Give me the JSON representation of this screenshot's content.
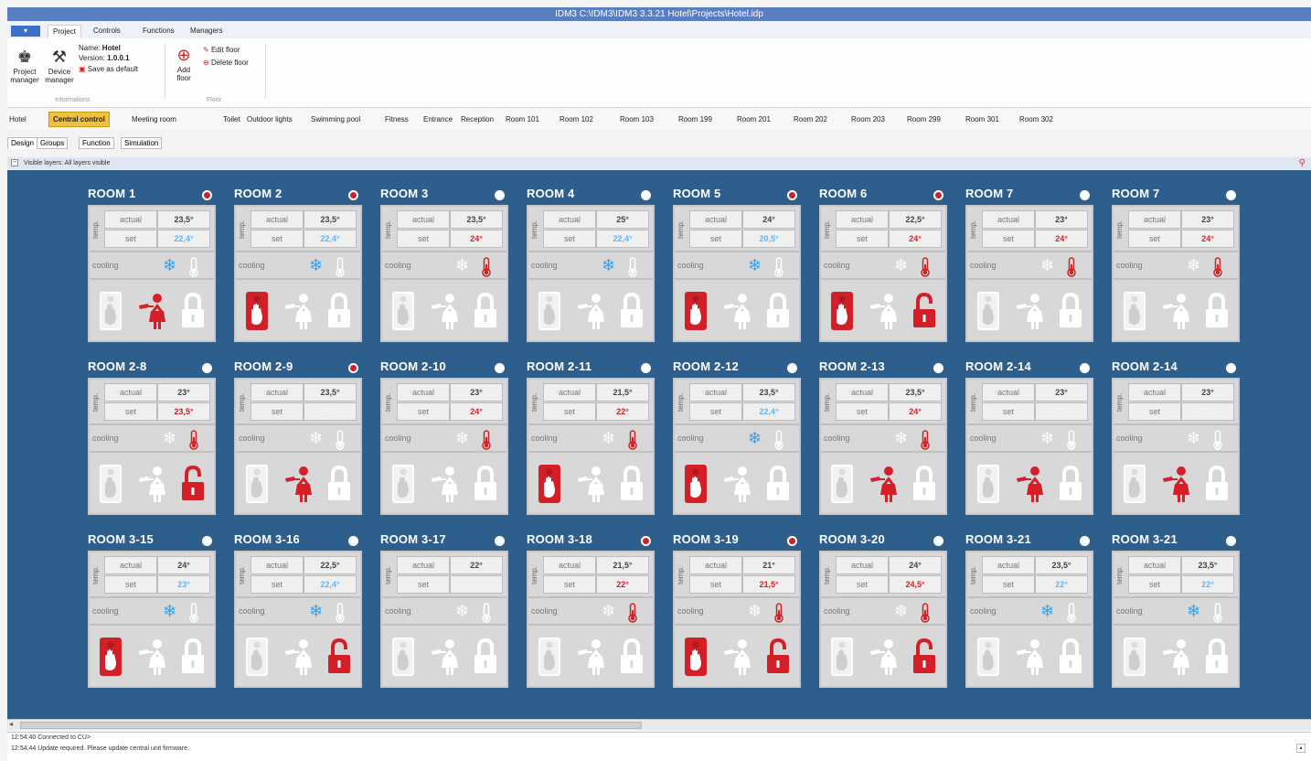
{
  "window": {
    "title": "IDM3 C:\\IDM3\\IDM3 3.3.21 Hotel\\Projects\\Hotel.idp"
  },
  "menu": {
    "file_label": "",
    "tabs": [
      "Project",
      "Controls",
      "Functions",
      "Managers"
    ],
    "active_tab": "Project"
  },
  "ribbon": {
    "project_manager": "Project manager",
    "device_manager": "Device manager",
    "name_label": "Name:",
    "name_value": "Hotel",
    "version_label": "Version:",
    "version_value": "1.0.0.1",
    "save_default": "Save as default",
    "group_info": "Informations",
    "add_floor": "Add floor",
    "edit_floor": "Edit floor",
    "delete_floor": "Delete floor",
    "group_floor": "Floor"
  },
  "floor_tabs": [
    "Hotel",
    "Central control",
    "Meeting room",
    "Toilet",
    "Outdoor lights",
    "Swimming pool",
    "Fitness",
    "Entrance",
    "Reception",
    "Room 101",
    "Room 102",
    "Room 103",
    "Room 199",
    "Room 201",
    "Room 202",
    "Room 203",
    "Room 299",
    "Room 301",
    "Room 302"
  ],
  "active_floor": "Central control",
  "view_tabs": [
    "Design",
    "Groups",
    "Function",
    "Simulation"
  ],
  "layers": {
    "text": "Visible layers: All layers visible",
    "toggle": "−"
  },
  "labels": {
    "temp": "temp.",
    "actual": "actual",
    "set": "set",
    "mode": "cooling"
  },
  "colors": {
    "canvas": "#2e5e8c",
    "alarm": "#d32028",
    "cooling_blue": "#62b4f0",
    "tile": "#d8d8d8"
  },
  "rooms": [
    {
      "name": "ROOM 1",
      "alarm": true,
      "actual": "23,5°",
      "set": "22,4°",
      "set_color": "blue",
      "cooling": true,
      "heating": false,
      "dnd": false,
      "maid": true,
      "unlocked": false
    },
    {
      "name": "ROOM 2",
      "alarm": true,
      "actual": "23,5°",
      "set": "22,4°",
      "set_color": "blue",
      "cooling": true,
      "heating": false,
      "dnd": true,
      "maid": false,
      "unlocked": false
    },
    {
      "name": "ROOM 3",
      "alarm": false,
      "actual": "23,5°",
      "set": "24°",
      "set_color": "red",
      "cooling": false,
      "heating": true,
      "dnd": false,
      "maid": false,
      "unlocked": false
    },
    {
      "name": "ROOM 4",
      "alarm": false,
      "actual": "25°",
      "set": "22,4°",
      "set_color": "blue",
      "cooling": true,
      "heating": false,
      "dnd": false,
      "maid": false,
      "unlocked": false
    },
    {
      "name": "ROOM 5",
      "alarm": true,
      "actual": "24°",
      "set": "20,5°",
      "set_color": "blue",
      "cooling": true,
      "heating": false,
      "dnd": true,
      "maid": false,
      "unlocked": false
    },
    {
      "name": "ROOM 6",
      "alarm": true,
      "actual": "22,5°",
      "set": "24°",
      "set_color": "red",
      "cooling": false,
      "heating": true,
      "dnd": true,
      "maid": false,
      "unlocked": true
    },
    {
      "name": "ROOM 7",
      "alarm": false,
      "actual": "23°",
      "set": "24°",
      "set_color": "red",
      "cooling": false,
      "heating": true,
      "dnd": false,
      "maid": false,
      "unlocked": false
    },
    {
      "name": "ROOM 7",
      "alarm": false,
      "actual": "23°",
      "set": "24°",
      "set_color": "red",
      "cooling": false,
      "heating": true,
      "dnd": false,
      "maid": false,
      "unlocked": false
    },
    {
      "name": "ROOM 2-8",
      "alarm": false,
      "actual": "23°",
      "set": "23,5°",
      "set_color": "red",
      "cooling": false,
      "heating": true,
      "dnd": false,
      "maid": false,
      "unlocked": true
    },
    {
      "name": "ROOM 2-9",
      "alarm": true,
      "actual": "23,5°",
      "set": "23,5°",
      "set_color": "white",
      "cooling": false,
      "heating": false,
      "dnd": false,
      "maid": true,
      "unlocked": false
    },
    {
      "name": "ROOM 2-10",
      "alarm": false,
      "actual": "23°",
      "set": "24°",
      "set_color": "red",
      "cooling": false,
      "heating": true,
      "dnd": false,
      "maid": false,
      "unlocked": false
    },
    {
      "name": "ROOM 2-11",
      "alarm": false,
      "actual": "21,5°",
      "set": "22°",
      "set_color": "red",
      "cooling": false,
      "heating": true,
      "dnd": true,
      "maid": false,
      "unlocked": false
    },
    {
      "name": "ROOM 2-12",
      "alarm": false,
      "actual": "23,5°",
      "set": "22,4°",
      "set_color": "blue",
      "cooling": true,
      "heating": false,
      "dnd": true,
      "maid": false,
      "unlocked": false
    },
    {
      "name": "ROOM 2-13",
      "alarm": false,
      "actual": "23,5°",
      "set": "24°",
      "set_color": "red",
      "cooling": false,
      "heating": true,
      "dnd": false,
      "maid": true,
      "unlocked": false
    },
    {
      "name": "ROOM 2-14",
      "alarm": false,
      "actual": "23°",
      "set": "23°",
      "set_color": "white",
      "cooling": false,
      "heating": false,
      "dnd": false,
      "maid": true,
      "unlocked": false
    },
    {
      "name": "ROOM 2-14",
      "alarm": false,
      "actual": "23°",
      "set": "23°",
      "set_color": "white",
      "cooling": false,
      "heating": false,
      "dnd": false,
      "maid": true,
      "unlocked": false
    },
    {
      "name": "ROOM 3-15",
      "alarm": false,
      "actual": "24°",
      "set": "23°",
      "set_color": "blue",
      "cooling": true,
      "heating": false,
      "dnd": true,
      "maid": false,
      "unlocked": false
    },
    {
      "name": "ROOM 3-16",
      "alarm": false,
      "actual": "22,5°",
      "set": "22,4°",
      "set_color": "blue",
      "cooling": true,
      "heating": false,
      "dnd": false,
      "maid": false,
      "unlocked": true
    },
    {
      "name": "ROOM 3-17",
      "alarm": false,
      "actual": "22°",
      "set": "22°",
      "set_color": "white",
      "cooling": false,
      "heating": false,
      "dnd": false,
      "maid": false,
      "unlocked": false
    },
    {
      "name": "ROOM 3-18",
      "alarm": true,
      "actual": "21,5°",
      "set": "22°",
      "set_color": "red",
      "cooling": false,
      "heating": true,
      "dnd": false,
      "maid": false,
      "unlocked": false
    },
    {
      "name": "ROOM 3-19",
      "alarm": true,
      "actual": "21°",
      "set": "21,5°",
      "set_color": "red",
      "cooling": false,
      "heating": true,
      "dnd": true,
      "maid": false,
      "unlocked": true
    },
    {
      "name": "ROOM 3-20",
      "alarm": false,
      "actual": "24°",
      "set": "24,5°",
      "set_color": "red",
      "cooling": false,
      "heating": true,
      "dnd": false,
      "maid": false,
      "unlocked": true
    },
    {
      "name": "ROOM 3-21",
      "alarm": false,
      "actual": "23,5°",
      "set": "22°",
      "set_color": "blue",
      "cooling": true,
      "heating": false,
      "dnd": false,
      "maid": false,
      "unlocked": false
    },
    {
      "name": "ROOM 3-21",
      "alarm": false,
      "actual": "23,5°",
      "set": "22°",
      "set_color": "blue",
      "cooling": true,
      "heating": false,
      "dnd": false,
      "maid": false,
      "unlocked": false
    }
  ],
  "log": [
    "12:54:40 Connected to CU>",
    "12:54:44 Update required. Please update central unit firmware."
  ]
}
